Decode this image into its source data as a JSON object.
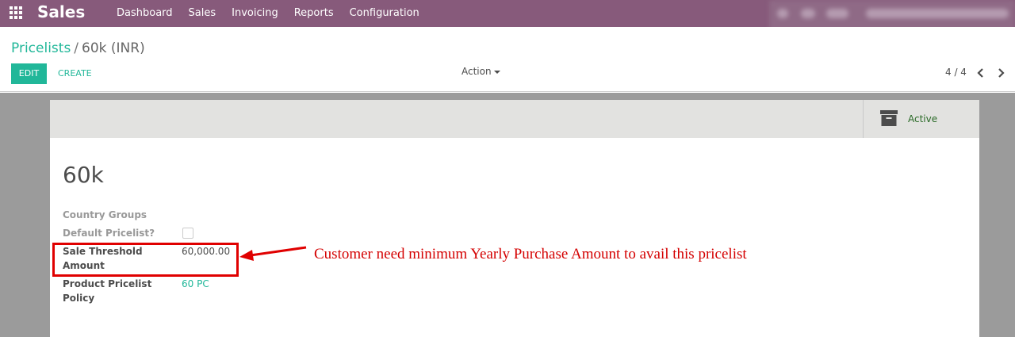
{
  "navbar": {
    "brand": "Sales",
    "menu": [
      "Dashboard",
      "Sales",
      "Invoicing",
      "Reports",
      "Configuration"
    ],
    "color": "#875a7b"
  },
  "breadcrumb": {
    "parent": "Pricelists",
    "separator": "/",
    "current": "60k (INR)"
  },
  "toolbar": {
    "edit_label": "EDIT",
    "create_label": "CREATE",
    "action_label": "Action",
    "accent_color": "#21b799"
  },
  "pager": {
    "value": "4 / 4"
  },
  "status": {
    "active_label": "Active"
  },
  "record": {
    "name": "60k",
    "fields": {
      "country_groups": {
        "label": "Country Groups",
        "value": ""
      },
      "default_pricelist": {
        "label": "Default Pricelist?",
        "checked": false
      },
      "sale_threshold": {
        "label_line1": "Sale Threshold",
        "label_line2": "Amount",
        "value": "60,000.00"
      },
      "product_policy": {
        "label_line1": "Product Pricelist",
        "label_line2": "Policy",
        "value": "60 PC"
      }
    }
  },
  "annotation": {
    "text": "Customer need minimum Yearly Purchase Amount to avail this pricelist",
    "color": "#e00000"
  }
}
